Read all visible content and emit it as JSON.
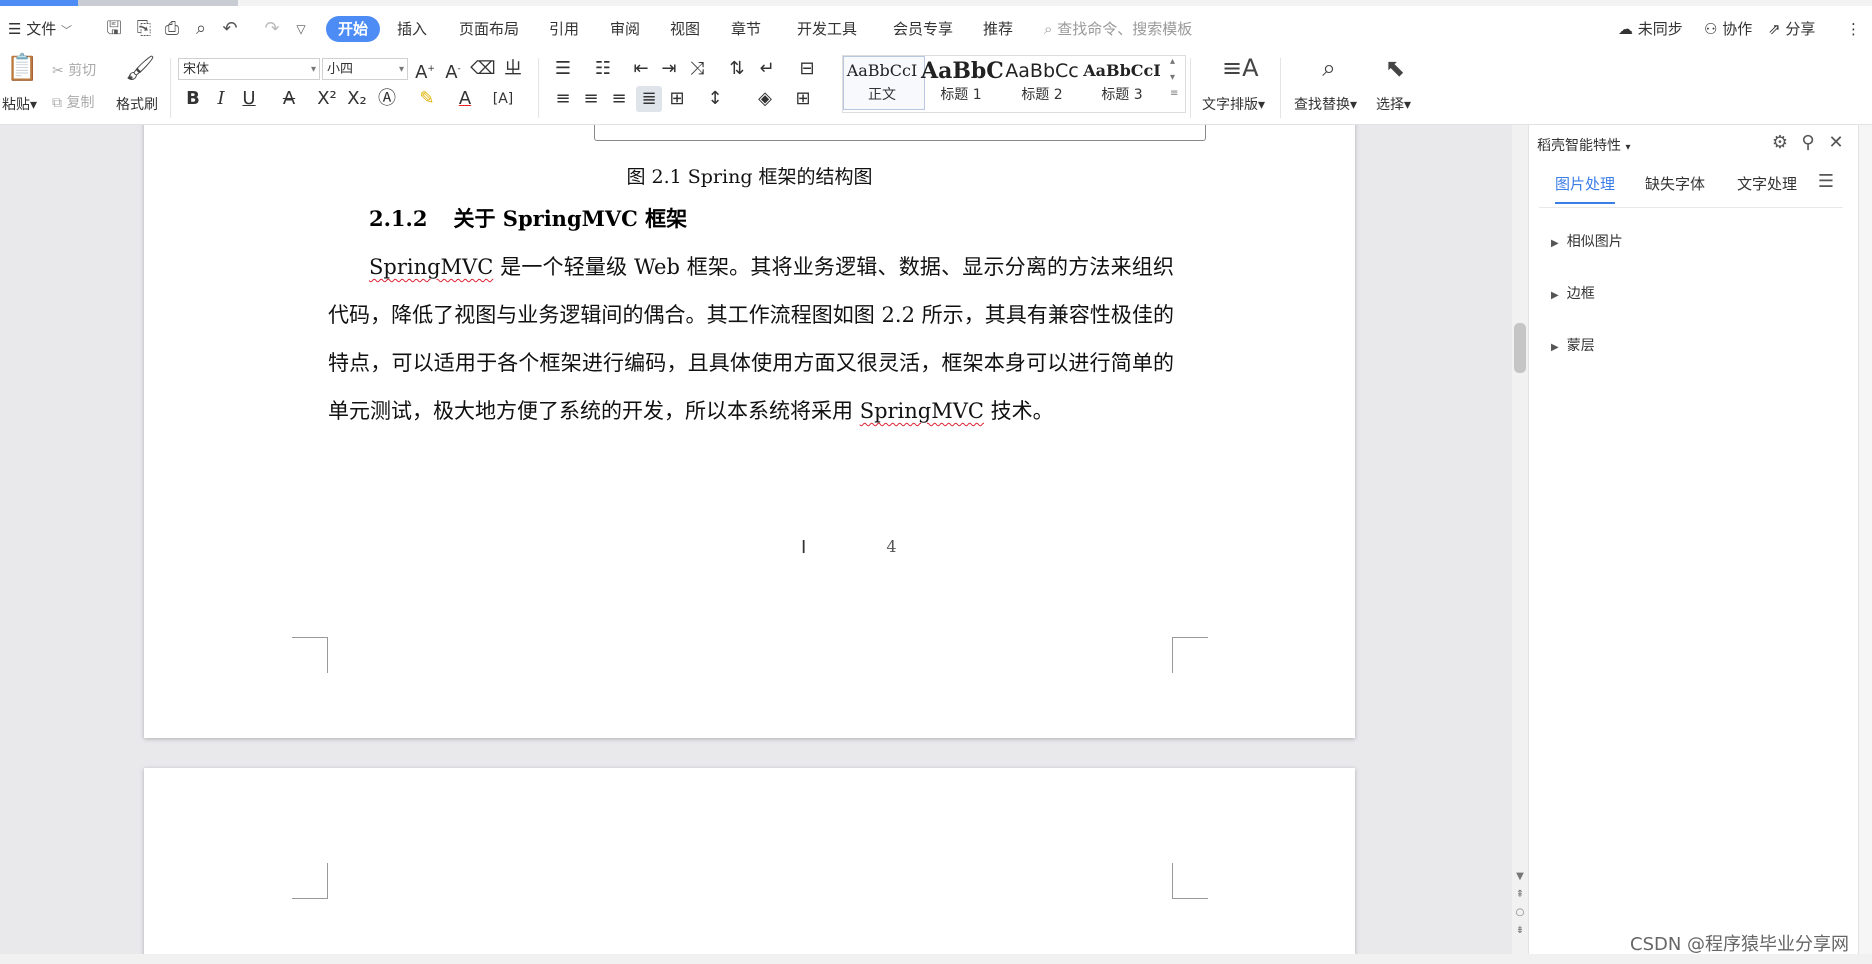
{
  "menubar": {
    "file_label": "文件",
    "tabs": [
      "开始",
      "插入",
      "页面布局",
      "引用",
      "审阅",
      "视图",
      "章节",
      "开发工具",
      "会员专享",
      "推荐"
    ],
    "active_tab": "开始",
    "search_placeholder": "查找命令、搜索模板",
    "sync_label": "未同步",
    "collab_label": "协作",
    "share_label": "分享"
  },
  "ribbon": {
    "paste_label": "粘贴",
    "cut_label": "剪切",
    "copy_label": "复制",
    "format_painter_label": "格式刷",
    "font_name": "宋体",
    "font_size": "小四",
    "styles": [
      {
        "sample": "AaBbCcI",
        "name": "正文"
      },
      {
        "sample": "AaBbC",
        "name": "标题 1"
      },
      {
        "sample": "AaBbCc",
        "name": "标题 2"
      },
      {
        "sample": "AaBbCcI",
        "name": "标题 3"
      }
    ],
    "text_layout_label": "文字排版",
    "find_replace_label": "查找替换",
    "select_label": "选择"
  },
  "document": {
    "figure_caption": "图 2.1 Spring 框架的结构图",
    "heading_number": "2.1.2",
    "heading_text": "关于 SpringMVC 框架",
    "paragraph_parts": [
      "SpringMVC",
      " 是一个轻量级 Web 框架。其将业务逻辑、数据、显示分离的方法来组织代码，降低了视图与业务逻辑间的偶合。其工作流程图如图 2.2 所示，其具有兼容性极佳的特点，可以适用于各个框架进行编码，且具体使用方面又很灵活，框架本身可以进行简单的单元测试，极大地方便了系统的开发，所以本系统将采用 ",
      "SpringMVC",
      " 技术。"
    ],
    "page_number": "4"
  },
  "panel": {
    "title": "稻壳智能特性",
    "tabs": [
      "图片处理",
      "缺失字体",
      "文字处理"
    ],
    "active_tab": "图片处理",
    "sections": [
      "相似图片",
      "边框",
      "蒙层"
    ]
  },
  "watermark": "CSDN @程序猿毕业分享网",
  "colors": {
    "accent": "#4e8cf5",
    "panel_tab_active": "#3b7ee8",
    "spell_underline": "#dd2233"
  }
}
